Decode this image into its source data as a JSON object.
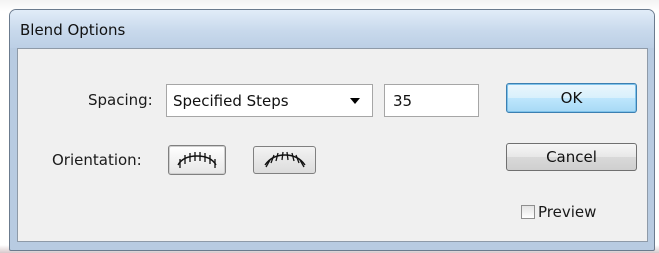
{
  "dialog": {
    "title": "Blend Options",
    "spacing": {
      "label": "Spacing:",
      "selected": "Specified Steps",
      "steps_value": "35"
    },
    "orientation": {
      "label": "Orientation:",
      "options": [
        "align-to-page-icon",
        "align-to-path-icon"
      ],
      "selected": "align-to-page-icon"
    },
    "buttons": {
      "ok": "OK",
      "cancel": "Cancel"
    },
    "preview": {
      "label": "Preview",
      "checked": false
    }
  }
}
